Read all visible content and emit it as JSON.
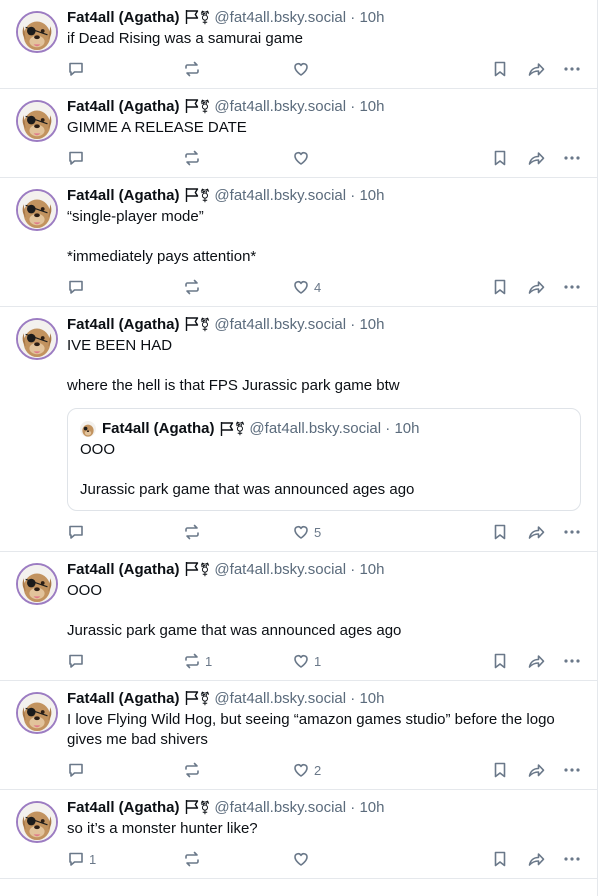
{
  "posts": [
    {
      "author": "Fat4all (Agatha)",
      "handle": "@fat4all.bsky.social",
      "separator": "·",
      "time": "10h",
      "text": [
        "if Dead Rising was a samurai game"
      ],
      "replies": "",
      "reposts": "",
      "likes": ""
    },
    {
      "author": "Fat4all (Agatha)",
      "handle": "@fat4all.bsky.social",
      "separator": "·",
      "time": "10h",
      "text": [
        "GIMME A RELEASE DATE"
      ],
      "replies": "",
      "reposts": "",
      "likes": ""
    },
    {
      "author": "Fat4all (Agatha)",
      "handle": "@fat4all.bsky.social",
      "separator": "·",
      "time": "10h",
      "text": [
        "“single-player mode”",
        "",
        "*immediately pays attention*"
      ],
      "replies": "",
      "reposts": "",
      "likes": "4"
    },
    {
      "author": "Fat4all (Agatha)",
      "handle": "@fat4all.bsky.social",
      "separator": "·",
      "time": "10h",
      "text": [
        "IVE BEEN HAD",
        "",
        "where the hell is that FPS Jurassic park game btw"
      ],
      "quote": {
        "author": "Fat4all (Agatha)",
        "handle": "@fat4all.bsky.social",
        "separator": "·",
        "time": "10h",
        "text": [
          "OOO",
          "",
          "Jurassic park game that was announced ages ago"
        ]
      },
      "replies": "",
      "reposts": "",
      "likes": "5"
    },
    {
      "author": "Fat4all (Agatha)",
      "handle": "@fat4all.bsky.social",
      "separator": "·",
      "time": "10h",
      "text": [
        "OOO",
        "",
        "Jurassic park game that was announced ages ago"
      ],
      "replies": "",
      "reposts": "1",
      "likes": "1"
    },
    {
      "author": "Fat4all (Agatha)",
      "handle": "@fat4all.bsky.social",
      "separator": "·",
      "time": "10h",
      "text": [
        "I love Flying Wild Hog, but seeing “amazon games studio” before the logo gives me bad shivers"
      ],
      "replies": "",
      "reposts": "",
      "likes": "2"
    },
    {
      "author": "Fat4all (Agatha)",
      "handle": "@fat4all.bsky.social",
      "separator": "·",
      "time": "10h",
      "text": [
        "so it’s a monster hunter like?"
      ],
      "replies": "1",
      "reposts": "",
      "likes": ""
    }
  ],
  "icons": {
    "reply": "speech-bubble-icon",
    "repost": "repost-arrows-icon",
    "like": "heart-outline-icon",
    "bookmark": "bookmark-icon",
    "share": "share-arrow-icon",
    "more": "more-dots-icon",
    "flag": "flag-outline-icon",
    "trans_symbol": "⚧"
  },
  "colors": {
    "text": "#0b0f14",
    "muted": "#5b6b7c",
    "icon": "#6a7889",
    "divider": "#e5e8ec",
    "avatar_ring": "#9c7cc2"
  }
}
